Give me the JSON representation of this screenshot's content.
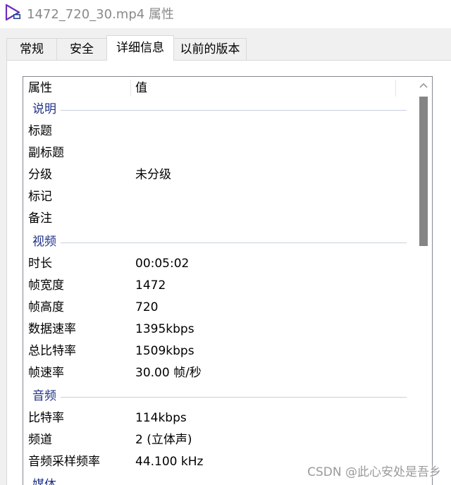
{
  "window": {
    "title": "1472_720_30.mp4 属性"
  },
  "tabs": [
    {
      "label": "常规"
    },
    {
      "label": "安全"
    },
    {
      "label": "详细信息"
    },
    {
      "label": "以前的版本"
    }
  ],
  "active_tab": "详细信息",
  "columns": {
    "name": "属性",
    "value": "值"
  },
  "groups": {
    "description": {
      "label": "说明",
      "rows": [
        {
          "name": "标题",
          "value": ""
        },
        {
          "name": "副标题",
          "value": ""
        },
        {
          "name": "分级",
          "value": "未分级"
        },
        {
          "name": "标记",
          "value": ""
        },
        {
          "name": "备注",
          "value": ""
        }
      ]
    },
    "video": {
      "label": "视频",
      "rows": [
        {
          "name": "时长",
          "value": "00:05:02"
        },
        {
          "name": "帧宽度",
          "value": "1472"
        },
        {
          "name": "帧高度",
          "value": "720"
        },
        {
          "name": "数据速率",
          "value": "1395kbps"
        },
        {
          "name": "总比特率",
          "value": "1509kbps"
        },
        {
          "name": "帧速率",
          "value": "30.00 帧/秒"
        }
      ]
    },
    "audio": {
      "label": "音频",
      "rows": [
        {
          "name": "比特率",
          "value": "114kbps"
        },
        {
          "name": "频道",
          "value": "2 (立体声)"
        },
        {
          "name": "音频采样频率",
          "value": "44.100 kHz"
        }
      ]
    },
    "media": {
      "label": "媒体"
    }
  },
  "watermark": "CSDN @此心安处是吾乡",
  "colors": {
    "group_label": "#1e3287",
    "scroll_thumb": "#858585"
  }
}
